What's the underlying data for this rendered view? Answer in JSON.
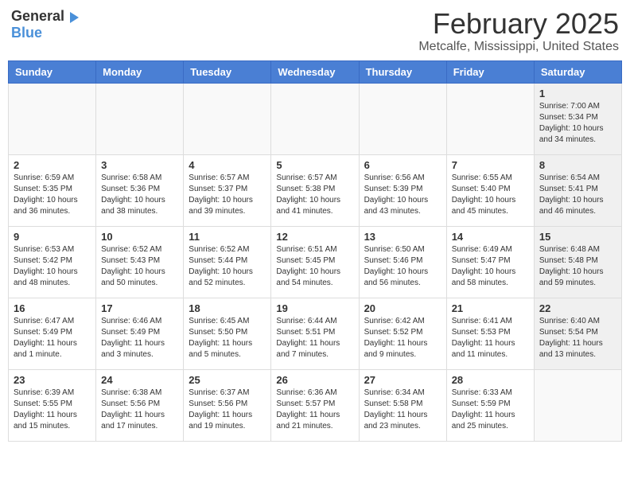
{
  "header": {
    "logo_general": "General",
    "logo_blue": "Blue",
    "month": "February 2025",
    "location": "Metcalfe, Mississippi, United States"
  },
  "weekdays": [
    "Sunday",
    "Monday",
    "Tuesday",
    "Wednesday",
    "Thursday",
    "Friday",
    "Saturday"
  ],
  "weeks": [
    [
      {
        "day": "",
        "info": ""
      },
      {
        "day": "",
        "info": ""
      },
      {
        "day": "",
        "info": ""
      },
      {
        "day": "",
        "info": ""
      },
      {
        "day": "",
        "info": ""
      },
      {
        "day": "",
        "info": ""
      },
      {
        "day": "1",
        "info": "Sunrise: 7:00 AM\nSunset: 5:34 PM\nDaylight: 10 hours and 34 minutes."
      }
    ],
    [
      {
        "day": "2",
        "info": "Sunrise: 6:59 AM\nSunset: 5:35 PM\nDaylight: 10 hours and 36 minutes."
      },
      {
        "day": "3",
        "info": "Sunrise: 6:58 AM\nSunset: 5:36 PM\nDaylight: 10 hours and 38 minutes."
      },
      {
        "day": "4",
        "info": "Sunrise: 6:57 AM\nSunset: 5:37 PM\nDaylight: 10 hours and 39 minutes."
      },
      {
        "day": "5",
        "info": "Sunrise: 6:57 AM\nSunset: 5:38 PM\nDaylight: 10 hours and 41 minutes."
      },
      {
        "day": "6",
        "info": "Sunrise: 6:56 AM\nSunset: 5:39 PM\nDaylight: 10 hours and 43 minutes."
      },
      {
        "day": "7",
        "info": "Sunrise: 6:55 AM\nSunset: 5:40 PM\nDaylight: 10 hours and 45 minutes."
      },
      {
        "day": "8",
        "info": "Sunrise: 6:54 AM\nSunset: 5:41 PM\nDaylight: 10 hours and 46 minutes."
      }
    ],
    [
      {
        "day": "9",
        "info": "Sunrise: 6:53 AM\nSunset: 5:42 PM\nDaylight: 10 hours and 48 minutes."
      },
      {
        "day": "10",
        "info": "Sunrise: 6:52 AM\nSunset: 5:43 PM\nDaylight: 10 hours and 50 minutes."
      },
      {
        "day": "11",
        "info": "Sunrise: 6:52 AM\nSunset: 5:44 PM\nDaylight: 10 hours and 52 minutes."
      },
      {
        "day": "12",
        "info": "Sunrise: 6:51 AM\nSunset: 5:45 PM\nDaylight: 10 hours and 54 minutes."
      },
      {
        "day": "13",
        "info": "Sunrise: 6:50 AM\nSunset: 5:46 PM\nDaylight: 10 hours and 56 minutes."
      },
      {
        "day": "14",
        "info": "Sunrise: 6:49 AM\nSunset: 5:47 PM\nDaylight: 10 hours and 58 minutes."
      },
      {
        "day": "15",
        "info": "Sunrise: 6:48 AM\nSunset: 5:48 PM\nDaylight: 10 hours and 59 minutes."
      }
    ],
    [
      {
        "day": "16",
        "info": "Sunrise: 6:47 AM\nSunset: 5:49 PM\nDaylight: 11 hours and 1 minute."
      },
      {
        "day": "17",
        "info": "Sunrise: 6:46 AM\nSunset: 5:49 PM\nDaylight: 11 hours and 3 minutes."
      },
      {
        "day": "18",
        "info": "Sunrise: 6:45 AM\nSunset: 5:50 PM\nDaylight: 11 hours and 5 minutes."
      },
      {
        "day": "19",
        "info": "Sunrise: 6:44 AM\nSunset: 5:51 PM\nDaylight: 11 hours and 7 minutes."
      },
      {
        "day": "20",
        "info": "Sunrise: 6:42 AM\nSunset: 5:52 PM\nDaylight: 11 hours and 9 minutes."
      },
      {
        "day": "21",
        "info": "Sunrise: 6:41 AM\nSunset: 5:53 PM\nDaylight: 11 hours and 11 minutes."
      },
      {
        "day": "22",
        "info": "Sunrise: 6:40 AM\nSunset: 5:54 PM\nDaylight: 11 hours and 13 minutes."
      }
    ],
    [
      {
        "day": "23",
        "info": "Sunrise: 6:39 AM\nSunset: 5:55 PM\nDaylight: 11 hours and 15 minutes."
      },
      {
        "day": "24",
        "info": "Sunrise: 6:38 AM\nSunset: 5:56 PM\nDaylight: 11 hours and 17 minutes."
      },
      {
        "day": "25",
        "info": "Sunrise: 6:37 AM\nSunset: 5:56 PM\nDaylight: 11 hours and 19 minutes."
      },
      {
        "day": "26",
        "info": "Sunrise: 6:36 AM\nSunset: 5:57 PM\nDaylight: 11 hours and 21 minutes."
      },
      {
        "day": "27",
        "info": "Sunrise: 6:34 AM\nSunset: 5:58 PM\nDaylight: 11 hours and 23 minutes."
      },
      {
        "day": "28",
        "info": "Sunrise: 6:33 AM\nSunset: 5:59 PM\nDaylight: 11 hours and 25 minutes."
      },
      {
        "day": "",
        "info": ""
      }
    ]
  ]
}
